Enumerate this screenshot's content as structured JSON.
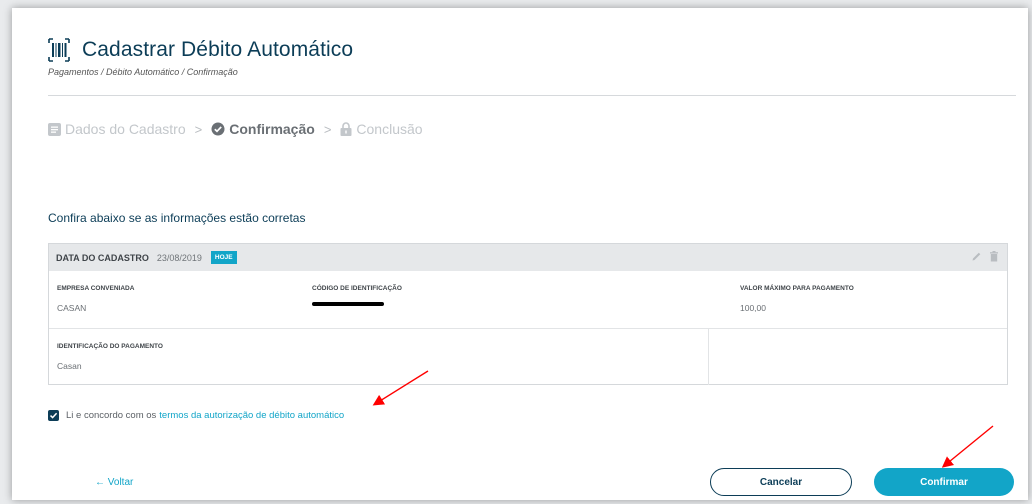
{
  "header": {
    "title": "Cadastrar Débito Automático",
    "breadcrumb": "Pagamentos / Débito Automático / Confirmação"
  },
  "steps": [
    {
      "label": "Dados do Cadastro",
      "icon": "list-icon",
      "state": "done"
    },
    {
      "label": "Confirmação",
      "icon": "check-circle-icon",
      "state": "active"
    },
    {
      "label": "Conclusão",
      "icon": "lock-icon",
      "state": "pending"
    }
  ],
  "step_separator": ">",
  "confirm_heading": "Confira abaixo se as informações estão corretas",
  "card": {
    "header_label": "DATA DO CADASTRO",
    "header_date": "23/08/2019",
    "badge": "HOJE",
    "fields": {
      "empresa_label": "EMPRESA CONVENIADA",
      "empresa_value": "CASAN",
      "codigo_label": "CÓDIGO DE IDENTIFICAÇÃO",
      "valor_label": "VALOR MÁXIMO PARA PAGAMENTO",
      "valor_value": "100,00",
      "ident_label": "IDENTIFICAÇÃO DO PAGAMENTO",
      "ident_value": "Casan"
    }
  },
  "terms": {
    "checked": true,
    "prefix": "Li e concordo com os",
    "link": "termos da autorização de débito automático"
  },
  "footer": {
    "back": "← Voltar",
    "cancel": "Cancelar",
    "confirm": "Confirmar"
  },
  "colors": {
    "primary": "#0c3d57",
    "accent": "#12a5c8",
    "annotation": "#ff0000"
  }
}
